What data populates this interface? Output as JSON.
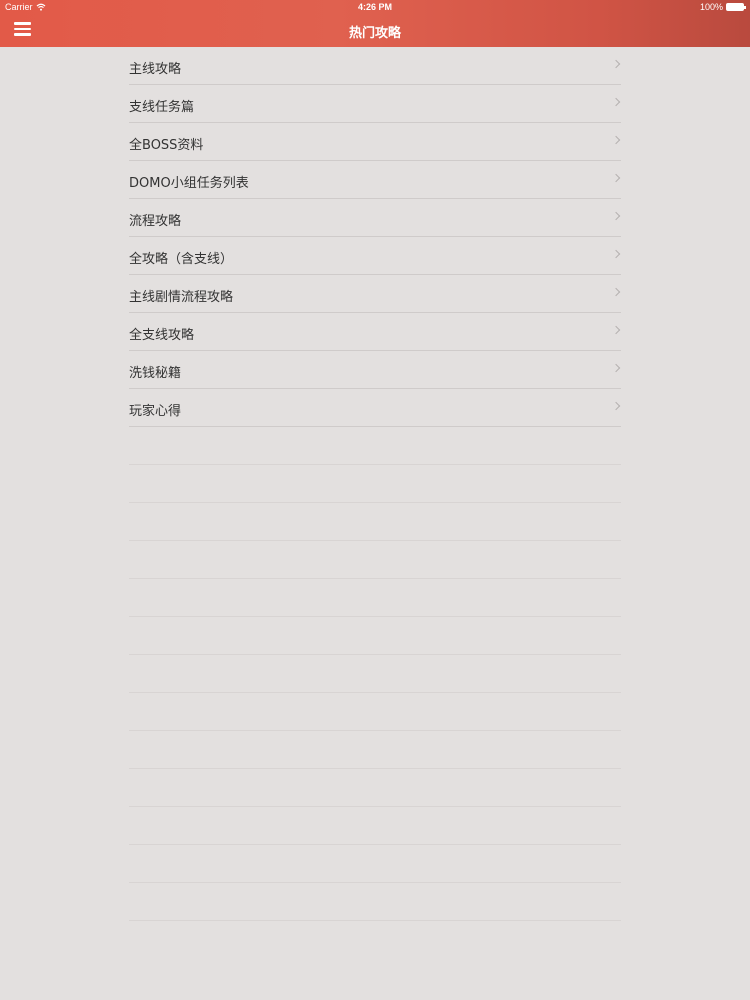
{
  "status_bar": {
    "carrier": "Carrier",
    "time": "4:26 PM",
    "battery": "100%",
    "wifi_icon": "wifi-icon",
    "battery_icon": "battery-icon"
  },
  "nav_bar": {
    "title": "热门攻略",
    "menu_icon": "hamburger-menu-icon",
    "color": "#e0614f"
  },
  "list": {
    "items": [
      {
        "label": "主线攻略"
      },
      {
        "label": "支线任务篇"
      },
      {
        "label": "全BOSS资料"
      },
      {
        "label": "DOMO小组任务列表"
      },
      {
        "label": "流程攻略"
      },
      {
        "label": "全攻略（含支线）"
      },
      {
        "label": "主线剧情流程攻略"
      },
      {
        "label": "全支线攻略"
      },
      {
        "label": "洗钱秘籍"
      },
      {
        "label": "玩家心得"
      }
    ],
    "chevron_icon": "chevron-right-icon"
  }
}
